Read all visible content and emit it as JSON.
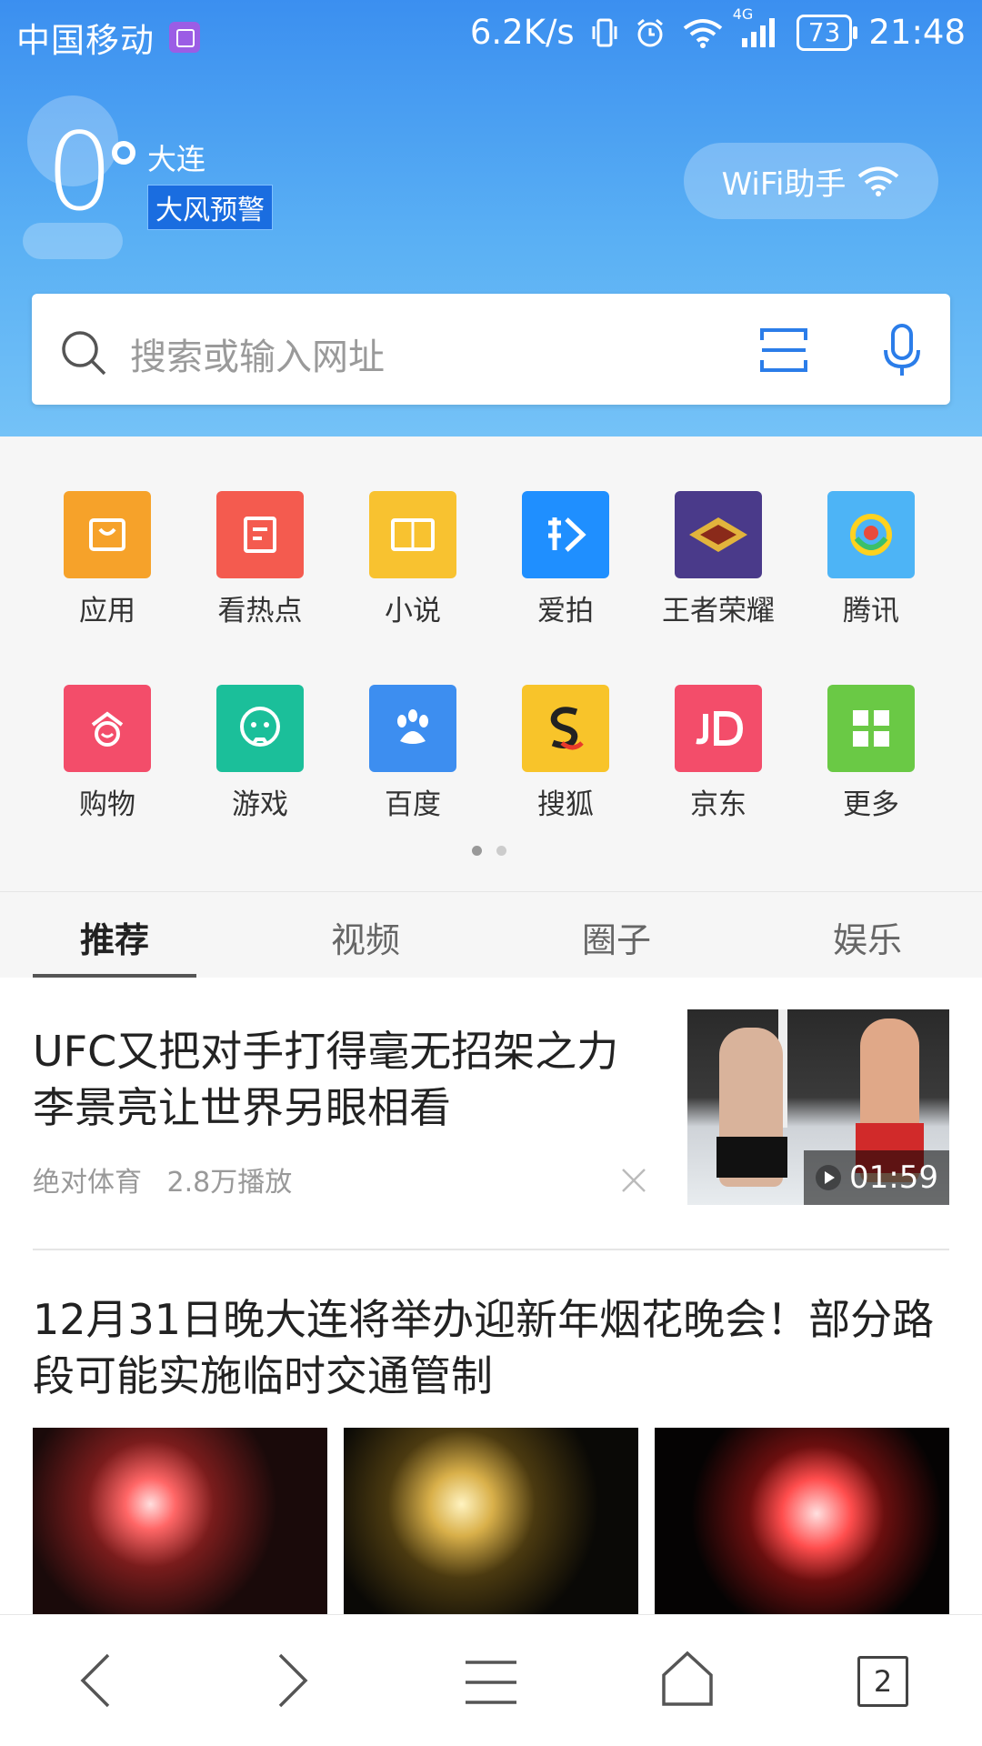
{
  "status_bar": {
    "carrier": "中国移动",
    "speed": "6.2K/s",
    "signal_label": "4G",
    "battery": "73",
    "time": "21:48"
  },
  "weather": {
    "temperature": "0",
    "city": "大连",
    "alert": "大风预警"
  },
  "wifi_button": {
    "label": "WiFi助手"
  },
  "search": {
    "placeholder": "搜索或输入网址"
  },
  "apps": [
    {
      "label": "应用",
      "color": "#f6a22a",
      "icon": "app-store-icon"
    },
    {
      "label": "看热点",
      "color": "#f45b4f",
      "icon": "hot-news-icon"
    },
    {
      "label": "小说",
      "color": "#f8c230",
      "icon": "book-icon"
    },
    {
      "label": "爱拍",
      "color": "#1f8fff",
      "icon": "aipai-icon"
    },
    {
      "label": "王者荣耀",
      "color": "#4a3a8a",
      "icon": "game-logo-icon"
    },
    {
      "label": "腾讯",
      "color": "#4db4f6",
      "icon": "tencent-icon"
    },
    {
      "label": "购物",
      "color": "#f34d6a",
      "icon": "shopping-icon"
    },
    {
      "label": "游戏",
      "color": "#1bbf9a",
      "icon": "game-icon"
    },
    {
      "label": "百度",
      "color": "#3d8ef0",
      "icon": "baidu-paw-icon"
    },
    {
      "label": "搜狐",
      "color": "#f8c42a",
      "icon": "sohu-icon"
    },
    {
      "label": "京东",
      "color": "#f34d6a",
      "icon": "jd-icon"
    },
    {
      "label": "更多",
      "color": "#6ac945",
      "icon": "more-grid-icon"
    }
  ],
  "tabs": [
    "推荐",
    "视频",
    "圈子",
    "娱乐"
  ],
  "articles": [
    {
      "title": "UFC又把对手打得毫无招架之力 李景亮让世界另眼相看",
      "source": "绝对体育",
      "plays": "2.8万播放",
      "duration": "01:59"
    },
    {
      "title": "12月31日晚大连将举办迎新年烟花晚会！部分路段可能实施临时交通管制"
    }
  ],
  "bottom_nav": {
    "tab_count": "2"
  }
}
